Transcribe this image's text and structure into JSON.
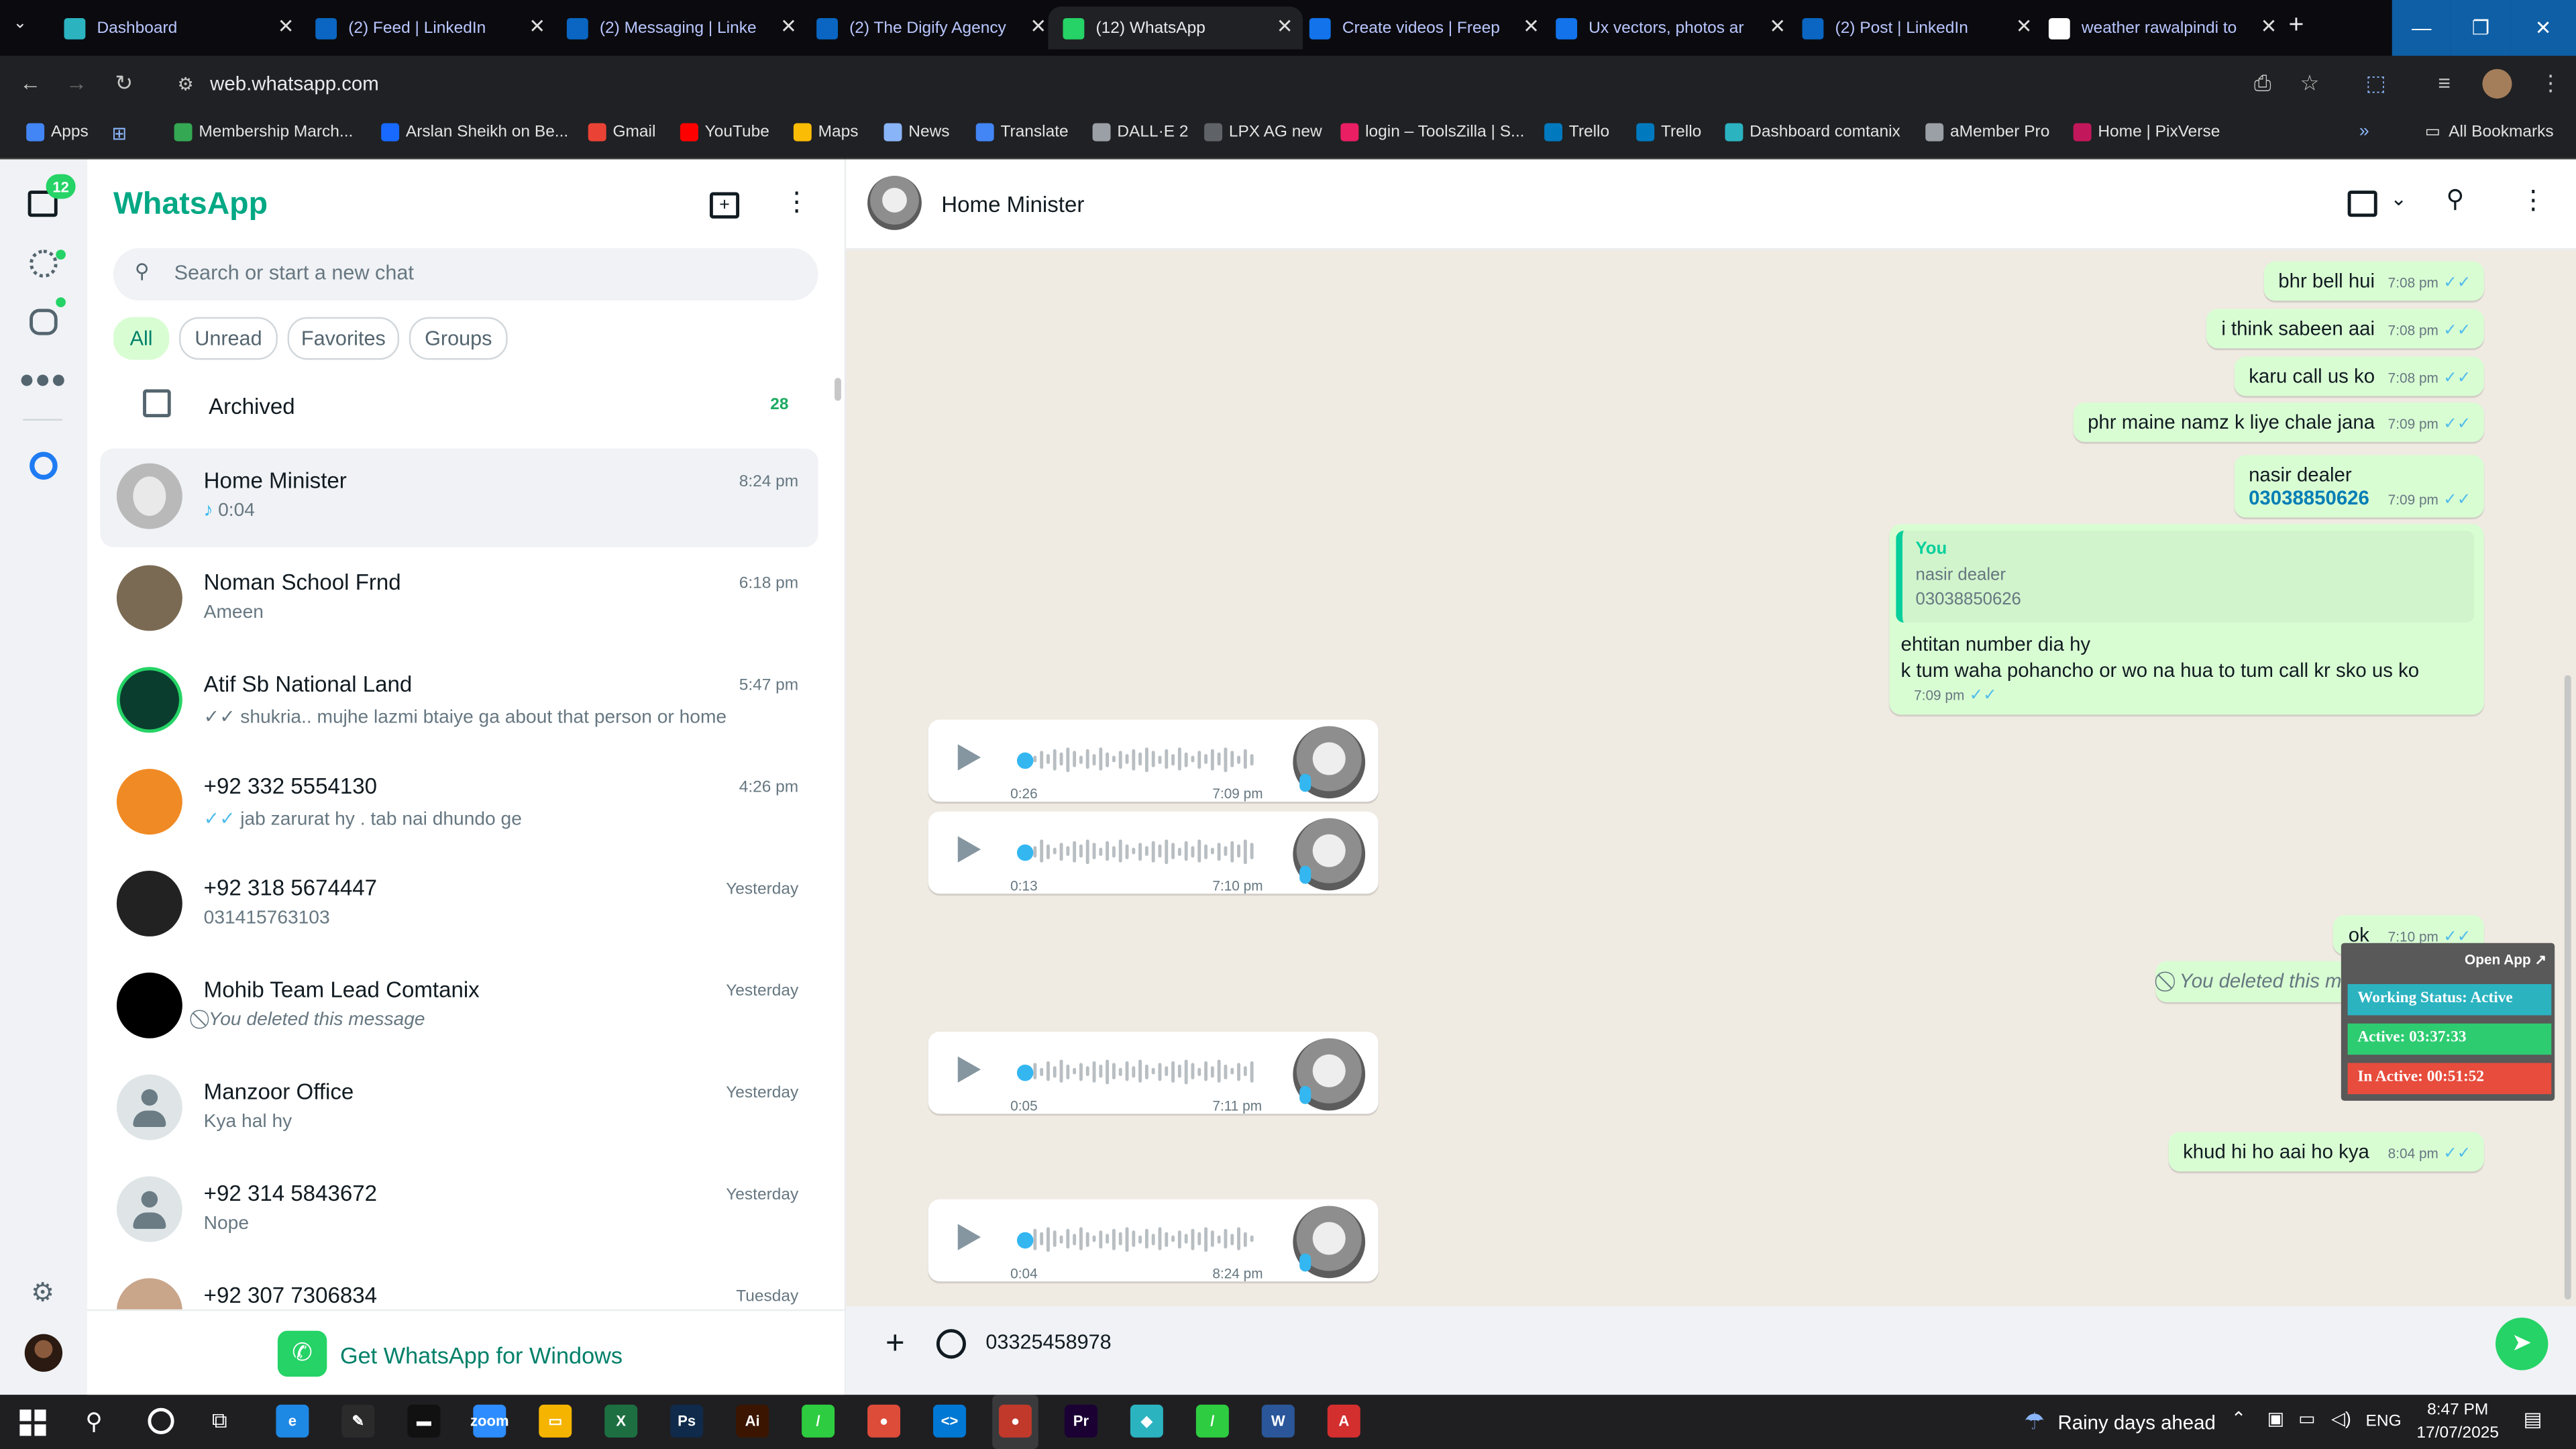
{
  "browser": {
    "tabs": [
      {
        "label": "Dashboard",
        "icon": "dashboard-icon",
        "color": "#2bb3c0"
      },
      {
        "label": "(2) Feed | LinkedIn",
        "icon": "linkedin-icon",
        "color": "#0a66c2"
      },
      {
        "label": "(2) Messaging | Linke",
        "icon": "linkedin-icon",
        "color": "#0a66c2"
      },
      {
        "label": "(2) The Digify Agency",
        "icon": "linkedin-icon",
        "color": "#0a66c2"
      },
      {
        "label": "(12) WhatsApp",
        "icon": "whatsapp-icon",
        "color": "#25d366"
      },
      {
        "label": "Create videos | Freep",
        "icon": "freepik-icon",
        "color": "#1273eb"
      },
      {
        "label": "Ux vectors, photos ar",
        "icon": "freepik-icon",
        "color": "#1273eb"
      },
      {
        "label": "(2) Post | LinkedIn",
        "icon": "linkedin-icon",
        "color": "#0a66c2"
      },
      {
        "label": "weather rawalpindi to",
        "icon": "google-icon",
        "color": "#ffffff"
      }
    ],
    "url": "web.whatsapp.com",
    "bookmarks": [
      {
        "label": "Apps",
        "color": "#4285f4"
      },
      {
        "label": "Membership March...",
        "color": "#34a853"
      },
      {
        "label": "Arslan Sheikh on Be...",
        "color": "#1769ff"
      },
      {
        "label": "Gmail",
        "color": "#ea4335"
      },
      {
        "label": "YouTube",
        "color": "#ff0000"
      },
      {
        "label": "Maps",
        "color": "#fbbc05"
      },
      {
        "label": "News",
        "color": "#8ab4f8"
      },
      {
        "label": "Translate",
        "color": "#4285f4"
      },
      {
        "label": "DALL·E 2",
        "color": "#9aa0a6"
      },
      {
        "label": "LPX AG new",
        "color": "#5f6368"
      },
      {
        "label": "login – ToolsZilla | S...",
        "color": "#e91e63"
      },
      {
        "label": "Trello",
        "color": "#0079bf"
      },
      {
        "label": "Trello",
        "color": "#0079bf"
      },
      {
        "label": "Dashboard comtanix",
        "color": "#2bb3c0"
      },
      {
        "label": "aMember Pro",
        "color": "#9aa0a6"
      },
      {
        "label": "Home | PixVerse",
        "color": "#c2185b"
      }
    ],
    "all_bookmarks": "All Bookmarks"
  },
  "whatsapp": {
    "brand": "WhatsApp",
    "brand_color": "#00a884",
    "unread_badge": "12",
    "search_placeholder": "Search or start a new chat",
    "filters": [
      "All",
      "Unread",
      "Favorites",
      "Groups"
    ],
    "archived_label": "Archived",
    "archived_count": "28",
    "chats": [
      {
        "name": "Home Minister",
        "time": "8:24 pm",
        "preview": "0:04",
        "avatar": "#b9b9b9"
      },
      {
        "name": "Noman School Frnd",
        "time": "6:18 pm",
        "preview": "Ameen",
        "avatar": "#7b6a53"
      },
      {
        "name": "Atif Sb National Land",
        "time": "5:47 pm",
        "preview": "shukria.. mujhe lazmi btaiye ga  about that person or home",
        "avatar": "#0b3d2e"
      },
      {
        "name": "+92 332 5554130",
        "time": "4:26 pm",
        "preview": "jab zarurat hy . tab nai dhundo ge",
        "avatar": "#f08a24"
      },
      {
        "name": "+92 318 5674447",
        "time": "Yesterday",
        "preview": "031415763103",
        "avatar": "#222222"
      },
      {
        "name": "Mohib Team Lead Comtanix",
        "time": "Yesterday",
        "preview": "You deleted this message",
        "avatar": "#000000"
      },
      {
        "name": "Manzoor Office",
        "time": "Yesterday",
        "preview": "Kya hal hy",
        "avatar": "#dfe5e7"
      },
      {
        "name": "+92 314 5843672",
        "time": "Yesterday",
        "preview": "Nope",
        "avatar": "#dfe5e7"
      },
      {
        "name": "+92 307 7306834",
        "time": "Tuesday",
        "preview": "",
        "avatar": "#c9a58a"
      }
    ],
    "get_app": "Get WhatsApp for Windows",
    "contact_name": "Home Minister",
    "messages_out": [
      {
        "text": "bhr bell hui",
        "time": "7:08 pm"
      },
      {
        "text": "i think sabeen aai",
        "time": "7:08 pm"
      },
      {
        "text": "karu call us ko",
        "time": "7:08 pm"
      },
      {
        "text": "phr maine namz k liye chale jana",
        "time": "7:09 pm"
      }
    ],
    "contact_msg": {
      "name": "nasir dealer",
      "number": "03038850626",
      "time": "7:09 pm"
    },
    "reply_msg": {
      "quote_author": "You",
      "quote_line1": "nasir dealer",
      "quote_line2": "03038850626",
      "line1": "ehtitan number dia hy",
      "line2": "k tum waha pohancho or wo na hua to tum call kr sko us ko",
      "time": "7:09 pm"
    },
    "voice_notes": [
      {
        "duration": "0:26",
        "time": "7:09 pm"
      },
      {
        "duration": "0:13",
        "time": "7:10 pm"
      },
      {
        "duration": "0:05",
        "time": "7:11 pm"
      },
      {
        "duration": "0:04",
        "time": "8:24 pm"
      }
    ],
    "ok_msg": {
      "text": "ok",
      "time": "7:10 pm"
    },
    "deleted_msg": "You deleted this message",
    "last_msg": {
      "text": "khud hi ho aai ho kya",
      "time": "8:04 pm"
    },
    "composer_value": "03325458978"
  },
  "tracker": {
    "open_app": "Open App ↗",
    "status": "Working Status: Active",
    "active": "Active: 03:37:33",
    "inactive": "In Active: 00:51:52"
  },
  "taskbar": {
    "weather": "Rainy days ahead",
    "lang": "ENG",
    "time": "8:47 PM",
    "date": "17/07/2025",
    "apps": [
      {
        "name": "edge-icon",
        "label": "e",
        "color": "#1e88e5"
      },
      {
        "name": "pen-icon",
        "label": "✎",
        "color": "#2b2b2b"
      },
      {
        "name": "terminal-icon",
        "label": "▬",
        "color": "#111111"
      },
      {
        "name": "zoom-icon",
        "label": "zoom",
        "color": "#2d8cff"
      },
      {
        "name": "explorer-icon",
        "label": "▭",
        "color": "#f4b400"
      },
      {
        "name": "excel-icon",
        "label": "X",
        "color": "#1d6f42"
      },
      {
        "name": "photoshop-icon",
        "label": "Ps",
        "color": "#0f2a4a"
      },
      {
        "name": "illustrator-icon",
        "label": "Ai",
        "color": "#3b1500"
      },
      {
        "name": "greenapp-icon",
        "label": "/",
        "color": "#2ecc40"
      },
      {
        "name": "chrome-icon",
        "label": "●",
        "color": "#dd4b39"
      },
      {
        "name": "vscode-icon",
        "label": "<>",
        "color": "#0078d4"
      },
      {
        "name": "chrome-profile-icon",
        "label": "●",
        "color": "#c0392b"
      },
      {
        "name": "premiere-icon",
        "label": "Pr",
        "color": "#1a0033"
      },
      {
        "name": "cyan-app-icon",
        "label": "◆",
        "color": "#2bb3c0"
      },
      {
        "name": "greenapp2-icon",
        "label": "/",
        "color": "#2ecc40"
      },
      {
        "name": "word-icon",
        "label": "W",
        "color": "#2b579a"
      },
      {
        "name": "acrobat-icon",
        "label": "A",
        "color": "#d32f2f"
      }
    ]
  }
}
